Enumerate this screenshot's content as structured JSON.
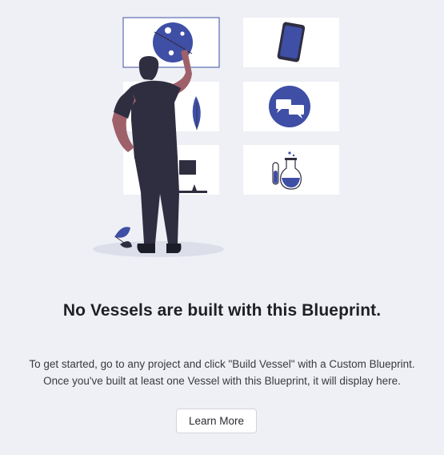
{
  "empty_state": {
    "illustration_icons": [
      "globe-icon",
      "phone-icon",
      "chat-bubbles-icon",
      "flask-icon",
      "leaf-icon",
      "signpost-icon",
      "person-figure"
    ],
    "heading": "No Vessels are built with this Blueprint.",
    "description_line_1": "To get started, go to any project and click \"Build Vessel\" with a Custom Blueprint.",
    "description_line_2": "Once you've built at least one Vessel with this Blueprint, it will display here.",
    "learn_more_label": "Learn More"
  },
  "colors": {
    "background": "#eef0f5",
    "accent": "#3f4fa6",
    "card": "#ffffff",
    "figure_dark": "#2f2e41",
    "skin": "#9e616a"
  }
}
